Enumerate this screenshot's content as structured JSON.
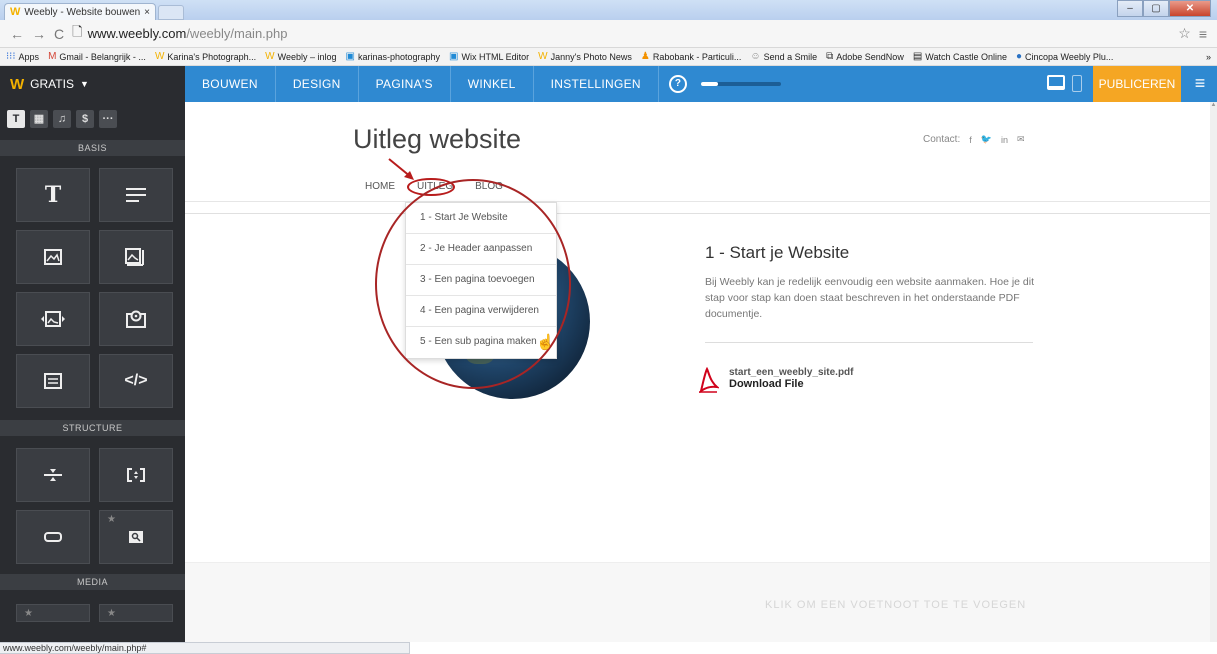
{
  "browser": {
    "tab_title": "Weebly - Website bouwen",
    "url_host": "www.weebly.com",
    "url_path": "/weebly/main.php",
    "status_url": "www.weebly.com/weebly/main.php#"
  },
  "bookmarks": [
    {
      "icon": "apps-icon",
      "label": "Apps"
    },
    {
      "icon": "gmail-icon",
      "label": "Gmail - Belangrijk - ..."
    },
    {
      "icon": "weebly-icon",
      "label": "Karina's Photograph..."
    },
    {
      "icon": "weebly-icon",
      "label": "Weebly – inlog"
    },
    {
      "icon": "wix-icon",
      "label": "karinas-photography"
    },
    {
      "icon": "wix-icon",
      "label": "Wix HTML Editor"
    },
    {
      "icon": "weebly-icon",
      "label": "Janny's Photo News"
    },
    {
      "icon": "rabobank-icon",
      "label": "Rabobank - Particuli..."
    },
    {
      "icon": "smile-icon",
      "label": "Send a Smile"
    },
    {
      "icon": "adobe-icon",
      "label": "Adobe SendNow"
    },
    {
      "icon": "castle-icon",
      "label": "Watch Castle Online"
    },
    {
      "icon": "cincopa-icon",
      "label": "Cincopa Weebly Plu..."
    }
  ],
  "topbar": {
    "plan_label": "GRATIS",
    "tabs": [
      "BOUWEN",
      "DESIGN",
      "PAGINA'S",
      "WINKEL",
      "INSTELLINGEN"
    ],
    "help_label": "?",
    "publish_label": "PUBLICEREN",
    "progress": 0.22,
    "colors": {
      "nav": "#2f89d1",
      "publish": "#f5a623",
      "dark": "#2d2f33"
    }
  },
  "sidebar": {
    "tab_icons": [
      "T",
      "▦",
      "♫",
      "$",
      "···"
    ],
    "sections": [
      {
        "title": "BASIS"
      },
      {
        "title": "STRUCTURE"
      },
      {
        "title": "MEDIA"
      }
    ]
  },
  "site": {
    "title": "Uitleg website",
    "contact_label": "Contact:",
    "nav": [
      "HOME",
      "UITLEG",
      "BLOG"
    ],
    "dropdown": [
      "1 - Start Je Website",
      "2 - Je Header aanpassen",
      "3 - Een pagina toevoegen",
      "4 - Een pagina verwijderen",
      "5 - Een sub pagina maken"
    ],
    "content_title": "1 - Start je Website",
    "content_body": "Bij Weebly kan je redelijk eenvoudig een website aanmaken. Hoe je dit stap  voor stap kan doen staat beschreven in het onderstaande PDF documentje.",
    "file_name": "start_een_weebly_site.pdf",
    "file_action": "Download File",
    "footer_placeholder": "KLIK OM EEN VOETNOOT TOE TE VOEGEN"
  }
}
